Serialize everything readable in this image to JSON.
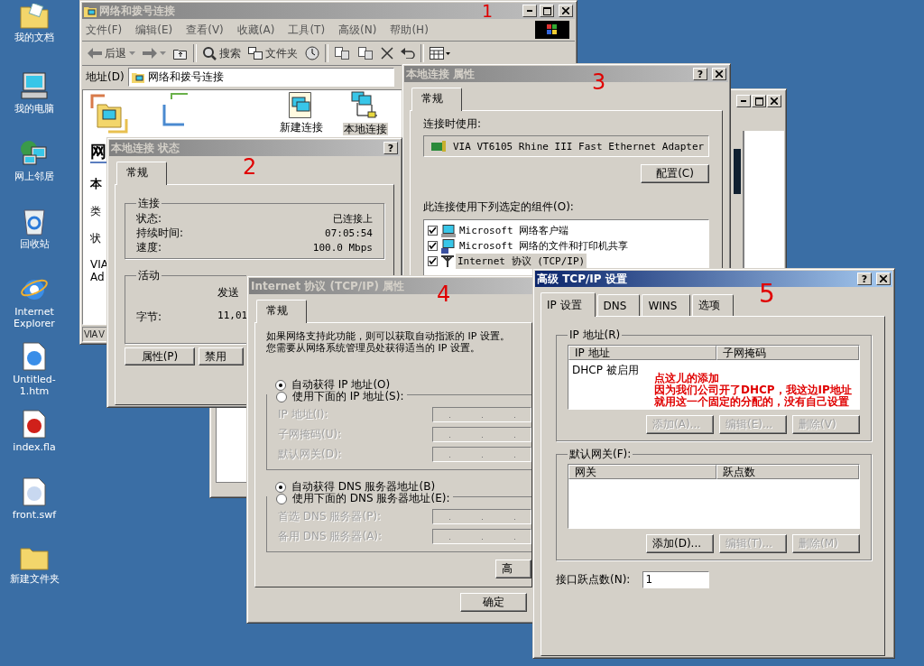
{
  "desktop_icons": [
    {
      "kind": "documents",
      "label": "我的文档"
    },
    {
      "kind": "computer",
      "label": "我的电脑"
    },
    {
      "kind": "network",
      "label": "网上邻居"
    },
    {
      "kind": "recycle",
      "label": "回收站"
    },
    {
      "kind": "browser",
      "label": "Internet Explorer"
    },
    {
      "kind": "webpage",
      "label": "Untitled-1.htm"
    },
    {
      "kind": "fla",
      "label": "index.fla"
    },
    {
      "kind": "swf",
      "label": "front.swf"
    },
    {
      "kind": "folder",
      "label": "新建文件夹"
    }
  ],
  "network_window": {
    "title": "网络和拨号连接",
    "marker": "1",
    "menu": [
      "文件(F)",
      "编辑(E)",
      "查看(V)",
      "收藏(A)",
      "工具(T)",
      "高级(N)",
      "帮助(H)"
    ],
    "toolbar": [
      {
        "kind": "back",
        "label": "后退"
      },
      {
        "kind": "forward"
      },
      {
        "kind": "up"
      },
      {
        "kind": "search",
        "label": "搜索"
      },
      {
        "kind": "folders",
        "label": "文件夹"
      },
      {
        "kind": "history"
      },
      {
        "kind": "move"
      },
      {
        "kind": "copy"
      },
      {
        "kind": "delete"
      },
      {
        "kind": "undo"
      },
      {
        "kind": "views"
      }
    ],
    "address_label": "地址(D)",
    "address": "网络和拨号连接",
    "heading": "网",
    "details": [
      "本",
      "类",
      "状",
      "VIA",
      "Ad"
    ],
    "icons": [
      {
        "label": "新建连接",
        "selected": false
      },
      {
        "label": "本地连接",
        "selected": true
      }
    ],
    "status_bar": "VIA V"
  },
  "status_dialog": {
    "title": "本地连接 状态",
    "marker": "2",
    "help_glyph": "?",
    "tabs": [
      {
        "label": "常规",
        "selected": true
      }
    ],
    "connection": {
      "legend": "连接",
      "rows": [
        {
          "label": "状态:",
          "value": "已连接上"
        },
        {
          "label": "持续时间:",
          "value": "07:05:54"
        },
        {
          "label": "速度:",
          "value": "100.0 Mbps"
        }
      ]
    },
    "activity": {
      "legend": "活动",
      "sent": "发送",
      "bytes_label": "字节:",
      "bytes_sent": "11,01"
    },
    "buttons": [
      "属性(P)",
      "禁用"
    ]
  },
  "properties_dialog": {
    "title": "本地连接 属性",
    "marker": "3",
    "help_glyph": "?",
    "tabs": [
      {
        "label": "常规",
        "selected": true
      }
    ],
    "connect_using_label": "连接时使用:",
    "adapter": "VIA VT6105 Rhine III Fast Ethernet Adapter",
    "configure_button": "配置(C)",
    "components_label": "此连接使用下列选定的组件(O):",
    "components": [
      {
        "kind": "client",
        "label": "Microsoft 网络客户端",
        "checked": true,
        "selected": false
      },
      {
        "kind": "sharing",
        "label": "Microsoft 网络的文件和打印机共享",
        "checked": true,
        "selected": false
      },
      {
        "kind": "protocol",
        "label": "Internet 协议 (TCP/IP)",
        "checked": true,
        "selected": true
      }
    ]
  },
  "tcpip_dialog": {
    "title": "Internet 协议 (TCP/IP) 属性",
    "marker": "4",
    "tabs": [
      {
        "label": "常规",
        "selected": true
      }
    ],
    "intro_lines": [
      "如果网络支持此功能，则可以获取自动指派的 IP 设置。",
      "您需要从网络系统管理员处获得适当的 IP 设置。"
    ],
    "ip_auto": {
      "label": "自动获得 IP 地址(O)",
      "selected": true
    },
    "ip_manual": {
      "label": "使用下面的 IP 地址(S):",
      "selected": false
    },
    "ip_fields": [
      {
        "label": "IP 地址(I):",
        "disabled": true
      },
      {
        "label": "子网掩码(U):",
        "disabled": true
      },
      {
        "label": "默认网关(D):",
        "disabled": true
      }
    ],
    "dns_auto": {
      "label": "自动获得 DNS 服务器地址(B)",
      "selected": true
    },
    "dns_manual": {
      "label": "使用下面的 DNS 服务器地址(E):",
      "selected": false
    },
    "dns_fields": [
      {
        "label": "首选 DNS 服务器(P):",
        "disabled": true
      },
      {
        "label": "备用 DNS 服务器(A):",
        "disabled": true
      }
    ],
    "advanced_button": "高",
    "ok_button": "确定"
  },
  "advanced_dialog": {
    "title": "高级 TCP/IP 设置",
    "marker": "5",
    "help_glyph": "?",
    "tabs": [
      {
        "label": "IP 设置",
        "selected": true
      },
      {
        "label": "DNS",
        "selected": false
      },
      {
        "label": "WINS",
        "selected": false
      },
      {
        "label": "选项",
        "selected": false
      }
    ],
    "ip_section": {
      "legend": "IP 地址(R)",
      "columns": [
        "IP 地址",
        "子网掩码"
      ],
      "rows": [
        [
          "DHCP 被启用"
        ]
      ],
      "buttons": [
        {
          "label": "添加(A)...",
          "disabled": true
        },
        {
          "label": "编辑(E)...",
          "disabled": true
        },
        {
          "label": "删除(V)",
          "disabled": true
        }
      ]
    },
    "note_lines": [
      "点这儿的添加",
      "因为我们公司开了DHCP，我这边IP地址",
      "就用这一个固定的分配的，没有自己设置"
    ],
    "gateway_section": {
      "legend": "默认网关(F):",
      "columns": [
        "网关",
        "跃点数"
      ],
      "buttons": [
        {
          "label": "添加(D)...",
          "disabled": false
        },
        {
          "label": "编辑(T)...",
          "disabled": true
        },
        {
          "label": "删除(M)",
          "disabled": true
        }
      ]
    },
    "metric_label": "接口跃点数(N):",
    "metric_value": "1"
  }
}
